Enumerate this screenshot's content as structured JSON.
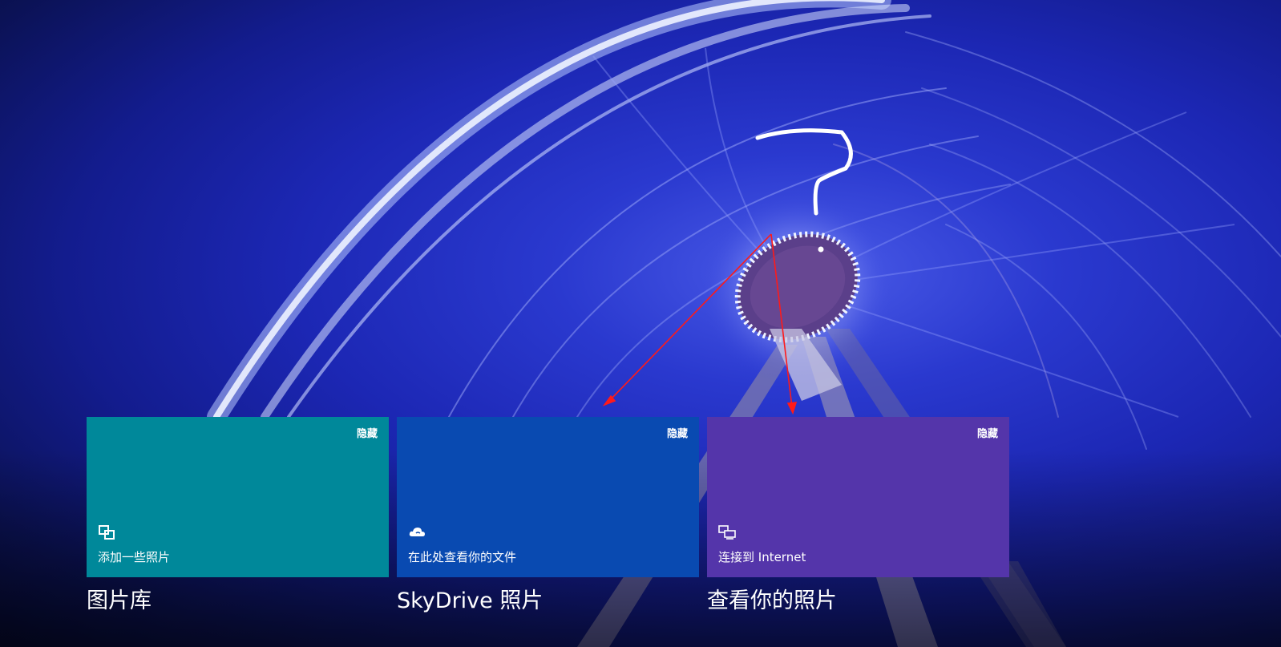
{
  "colors": {
    "tile_library": "#00889a",
    "tile_skydrive": "#094ab1",
    "tile_internet": "#5435aa",
    "text": "#ffffff",
    "annotation_arrow": "#ff0000"
  },
  "tiles": [
    {
      "hide_label": "隐藏",
      "icon": "add-photos-icon",
      "text": "添加一些照片",
      "group_title": "图片库"
    },
    {
      "hide_label": "隐藏",
      "icon": "cloud-icon",
      "text": "在此处查看你的文件",
      "group_title": "SkyDrive 照片"
    },
    {
      "hide_label": "隐藏",
      "icon": "connected-devices-icon",
      "text": "连接到 Internet",
      "group_title": "查看你的照片"
    }
  ],
  "annotations": {
    "question_mark": "?",
    "arrow_count": 2
  }
}
